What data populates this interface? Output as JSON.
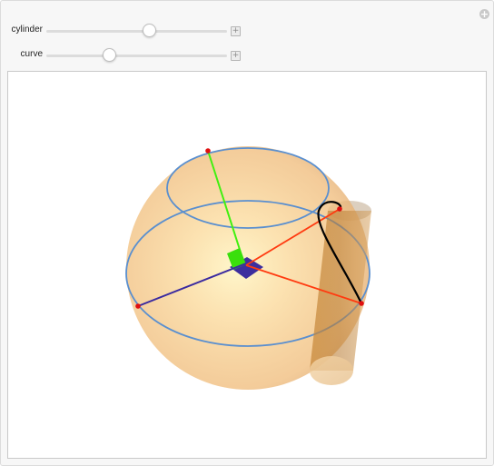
{
  "controls": {
    "cylinder": {
      "label": "cylinder",
      "value": 0.57
    },
    "curve": {
      "label": "curve",
      "value": 0.35
    }
  },
  "corner_button": {
    "icon": "plus-circle-icon"
  },
  "scene": {
    "sphere_color": "#f5c27a",
    "circle_color": "#5a8fcf",
    "cylinder_color": "#c88a3a",
    "curve_color": "#000000",
    "green_axis_color": "#33e010",
    "blue_axis_color": "#3a2aa0",
    "red_axis_color": "#ff3a10",
    "point_color": "#e01010"
  }
}
